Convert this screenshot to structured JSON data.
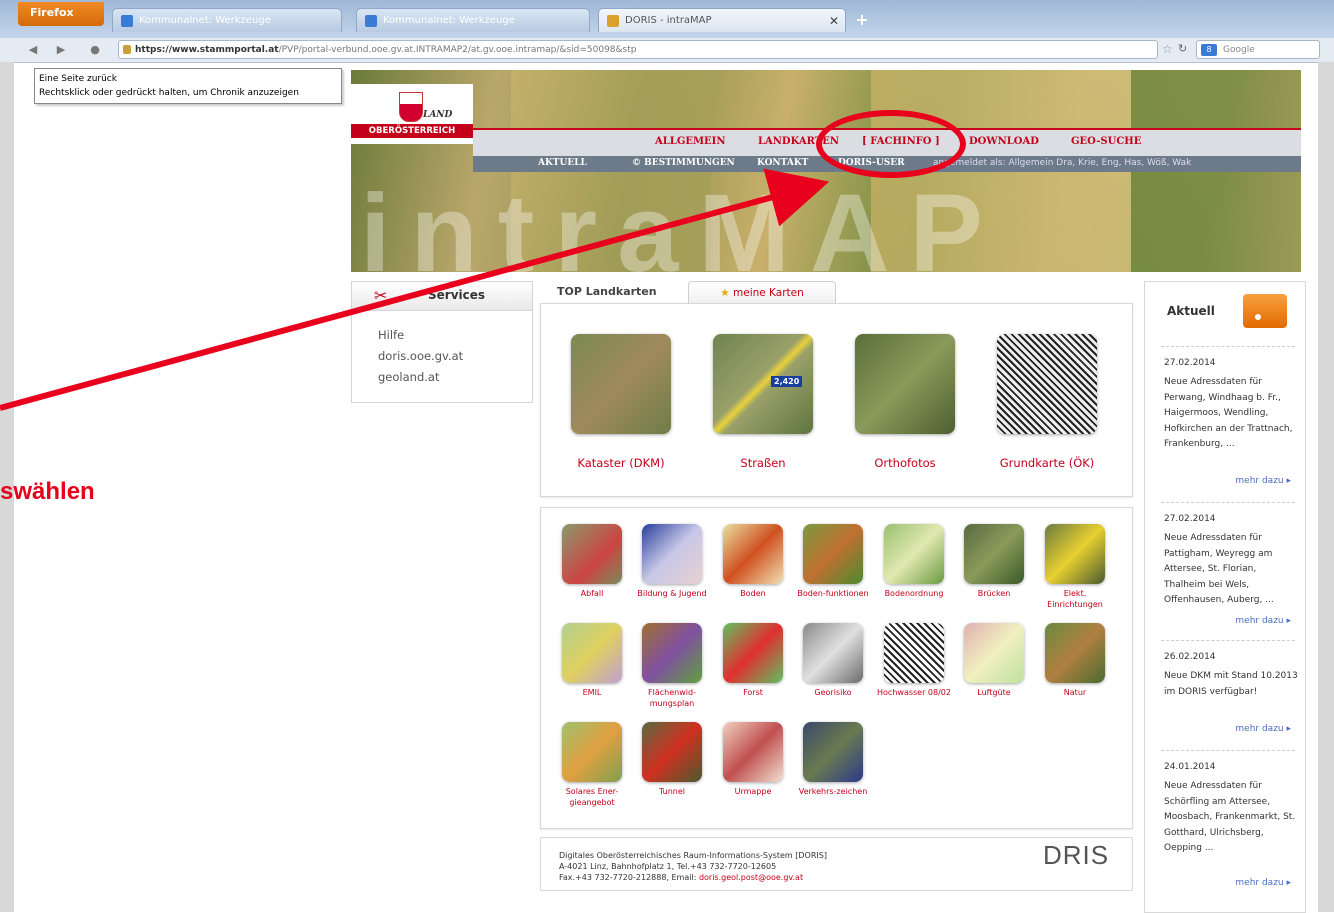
{
  "browser": {
    "firefox_label": "Firefox",
    "tabs": [
      {
        "label": "Kommunalnet: Werkzeuge"
      },
      {
        "label": "Kommunalnet: Werkzeuge"
      },
      {
        "label": "DORIS - intraMAP"
      }
    ],
    "new_tab": "+",
    "url_host": "https://www.stammportal.at",
    "url_path": "/PVP/portal-verbund.ooe.gv.at.INTRAMAP2/at.gv.ooe.intramap/&sid=50098&stp",
    "search_placeholder": "Google",
    "tooltip_line1": "Eine Seite zurück",
    "tooltip_line2": "Rechtsklick oder gedrückt halten, um Chronik anzuzeigen"
  },
  "header": {
    "logo_land": "LAND",
    "logo_state": "OBERÖSTERREICH",
    "menu_primary": [
      "ALLGEMEIN",
      "LANDKARTEN",
      "[ FACHINFO ]",
      "DOWNLOAD",
      "GEO-SUCHE"
    ],
    "menu_secondary": [
      "AKTUELL",
      "© BESTIMMUNGEN",
      "KONTAKT",
      "DORIS-USER"
    ],
    "login_text": "angemeldet als: Allgemein Dra, Krie, Eng, Has, Wöß, Wak",
    "banner_text": "intraMAP"
  },
  "annotation": {
    "text": "swählen"
  },
  "services": {
    "title": "Services",
    "links": [
      "Hilfe",
      "doris.ooe.gv.at",
      "geoland.at"
    ]
  },
  "top_maps": {
    "tab_active": "TOP Landkarten",
    "tab_other": "meine Karten",
    "maps": [
      "Kataster (DKM)",
      "Straßen",
      "Orthofotos",
      "Grundkarte (ÖK)"
    ],
    "road_badges": [
      "2,420"
    ]
  },
  "themes": {
    "row1": [
      "Abfall",
      "Bildung & Jugend",
      "Boden",
      "Boden-funktionen",
      "Bodenordnung",
      "Brücken",
      "Elekt. Einrichtungen"
    ],
    "row2": [
      "EMIL",
      "Flächenwid-mungsplan",
      "Forst",
      "Georisiko",
      "Hochwasser 08/02",
      "Luftgüte",
      "Natur"
    ],
    "row3": [
      "Solares Ener-gieangebot",
      "Tunnel",
      "Urmappe",
      "Verkehrs-zeichen"
    ]
  },
  "footer": {
    "line1": "Digitales Oberösterreichisches Raum-Informations-System [DORIS]",
    "line2": "A-4021 Linz, Bahnhofplatz 1, Tel.+43 732-7720-12605",
    "line3": "Fax.+43 732-7720-212888, Email: ",
    "email": "doris.geol.post@ooe.gv.at",
    "logo": "DRIS"
  },
  "aktuell": {
    "title": "Aktuell",
    "more_label": "mehr dazu ▸",
    "items": [
      {
        "date": "27.02.2014",
        "text": "Neue Adressdaten für Perwang, Windhaag b. Fr., Haigermoos, Wendling, Hofkirchen an der Trattnach, Frankenburg, ..."
      },
      {
        "date": "27.02.2014",
        "text": "Neue Adressdaten für Pattigham, Weyregg am Attersee, St. Florian, Thalheim bei Wels, Offenhausen, Auberg, ..."
      },
      {
        "date": "26.02.2014",
        "text": "Neue DKM mit Stand 10.2013 im DORIS verfügbar!"
      },
      {
        "date": "24.01.2014",
        "text": "Neue Adressdaten für Schörfling am Attersee, Moosbach, Frankenmarkt, St. Gotthard, Ulrichsberg, Oepping ..."
      }
    ]
  }
}
